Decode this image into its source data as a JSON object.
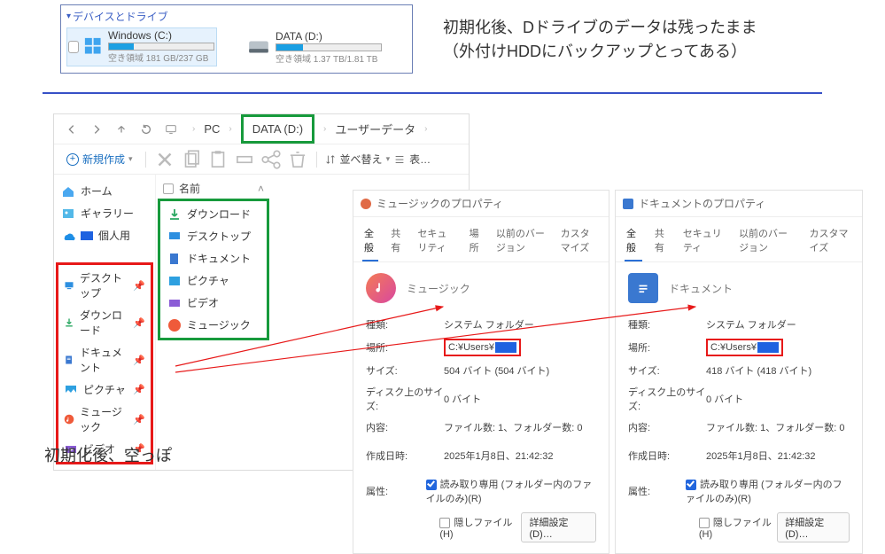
{
  "devices": {
    "header": "デバイスとドライブ",
    "drive_c": {
      "label": "Windows (C:)",
      "sub": "空き領域 181 GB/237 GB",
      "fill": 24
    },
    "drive_d": {
      "label": "DATA (D:)",
      "sub": "空き領域 1.37 TB/1.81 TB",
      "fill": 25
    }
  },
  "annot_top_1": "初期化後、Dドライブのデータは残ったまま",
  "annot_top_2": "（外付けHDDにバックアップとってある）",
  "explorer": {
    "breadcrumb": {
      "pc": "PC",
      "d": "DATA (D:)",
      "user": "ユーザーデータ"
    },
    "newBtn": "新規作成",
    "sort": "並べ替え",
    "view": "表…",
    "col_name": "名前",
    "sidebar": {
      "home": "ホーム",
      "gallery": "ギャラリー",
      "personal": "個人用",
      "desktop": "デスクトップ",
      "downloads": "ダウンロード",
      "documents": "ドキュメント",
      "pictures": "ピクチャ",
      "music": "ミュージック",
      "videos": "ビデオ"
    },
    "folders": {
      "downloads": "ダウンロード",
      "desktop": "デスクトップ",
      "documents": "ドキュメント",
      "pictures": "ピクチャ",
      "videos": "ビデオ",
      "music": "ミュージック"
    }
  },
  "annot_bottom": "初期化後、空っぽ",
  "prop_music": {
    "title": "ミュージックのプロパティ",
    "tabs": {
      "general": "全般",
      "share": "共有",
      "security": "セキュリティ",
      "location": "場所",
      "prev": "以前のバージョン",
      "custom": "カスタマイズ"
    },
    "name": "ミュージック",
    "rows": {
      "kind_l": "種類:",
      "kind_v": "システム フォルダー",
      "loc_l": "場所:",
      "loc_v": "C:¥Users¥",
      "size_l": "サイズ:",
      "size_v": "504 バイト (504 バイト)",
      "disk_l": "ディスク上のサイズ:",
      "disk_v": "0 バイト",
      "cont_l": "内容:",
      "cont_v": "ファイル数: 1、フォルダー数: 0",
      "date_l": "作成日時:",
      "date_v": "2025年1月8日、21:42:32",
      "attr_l": "属性:",
      "ro": "読み取り専用 (フォルダー内のファイルのみ)(R)",
      "hidden": "隠しファイル(H)",
      "details": "詳細設定(D)…"
    }
  },
  "prop_doc": {
    "title": "ドキュメントのプロパティ",
    "tabs": {
      "general": "全般",
      "share": "共有",
      "security": "セキュリティ",
      "prev": "以前のバージョン",
      "custom": "カスタマイズ"
    },
    "name": "ドキュメント",
    "rows": {
      "kind_l": "種類:",
      "kind_v": "システム フォルダー",
      "loc_l": "場所:",
      "loc_v": "C:¥Users¥",
      "size_l": "サイズ:",
      "size_v": "418 バイト (418 バイト)",
      "disk_l": "ディスク上のサイズ:",
      "disk_v": "0 バイト",
      "cont_l": "内容:",
      "cont_v": "ファイル数: 1、フォルダー数: 0",
      "date_l": "作成日時:",
      "date_v": "2025年1月8日、21:42:32",
      "attr_l": "属性:",
      "ro": "読み取り専用 (フォルダー内のファイルのみ)(R)",
      "hidden": "隠しファイル(H)",
      "details": "詳細設定(D)…"
    }
  }
}
